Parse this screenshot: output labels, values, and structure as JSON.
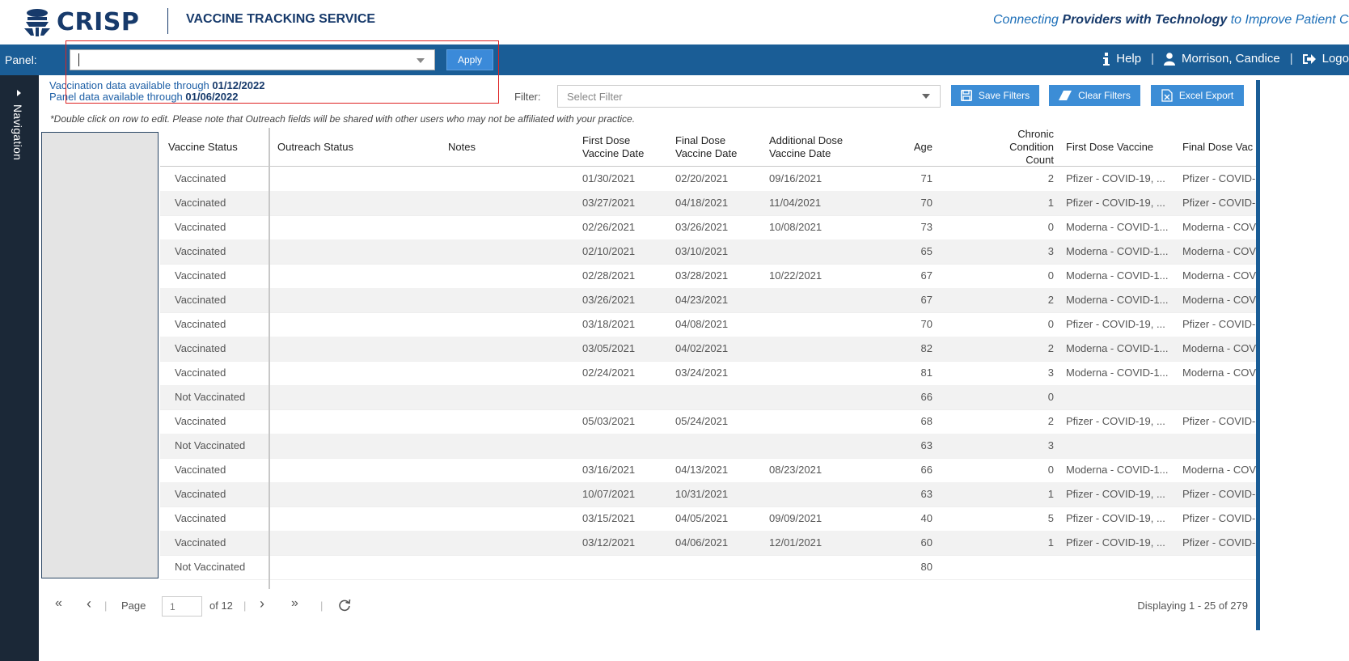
{
  "header": {
    "logo_text": "CRISP",
    "app_title": "VACCINE TRACKING SERVICE",
    "tagline_before": "Connecting ",
    "tagline_bold": "Providers with Technology",
    "tagline_after": " to Improve Patient Ca"
  },
  "panel_bar": {
    "label": "Panel:",
    "panel_value": "",
    "apply_label": "Apply",
    "help_label": "Help",
    "user_name": "Morrison, Candice",
    "logout_label": "Logo"
  },
  "navigation": {
    "label": "Navigation"
  },
  "info": {
    "vax_text": "Vaccination data available through ",
    "vax_date": "01/12/2022",
    "panel_text": "Panel data available through ",
    "panel_date": "01/06/2022"
  },
  "filter": {
    "label": "Filter:",
    "placeholder": "Select Filter",
    "save_label": "Save Filters",
    "clear_label": "Clear Filters",
    "export_label": "Excel Export"
  },
  "note": "*Double click on row to edit. Please note that Outreach fields will be shared with other users who may not be affiliated with your practice.",
  "table": {
    "columns": [
      {
        "l1": "Vaccine Status",
        "l2": ""
      },
      {
        "l1": "Outreach Status",
        "l2": ""
      },
      {
        "l1": "Notes",
        "l2": ""
      },
      {
        "l1": "First Dose",
        "l2": "Vaccine Date"
      },
      {
        "l1": "Final Dose",
        "l2": "Vaccine Date"
      },
      {
        "l1": "Additional Dose",
        "l2": "Vaccine Date"
      },
      {
        "l1": "Age",
        "l2": ""
      },
      {
        "l1": "Chronic",
        "l2": "Condition Count"
      },
      {
        "l1": "First Dose Vaccine",
        "l2": ""
      },
      {
        "l1": "Final Dose Vac",
        "l2": ""
      }
    ],
    "rows": [
      [
        "Vaccinated",
        "",
        "",
        "01/30/2021",
        "02/20/2021",
        "09/16/2021",
        "71",
        "2",
        "Pfizer - COVID-19, ...",
        "Pfizer - COVID-"
      ],
      [
        "Vaccinated",
        "",
        "",
        "03/27/2021",
        "04/18/2021",
        "11/04/2021",
        "70",
        "1",
        "Pfizer - COVID-19, ...",
        "Pfizer - COVID-"
      ],
      [
        "Vaccinated",
        "",
        "",
        "02/26/2021",
        "03/26/2021",
        "10/08/2021",
        "73",
        "0",
        "Moderna - COVID-1...",
        "Moderna - COV"
      ],
      [
        "Vaccinated",
        "",
        "",
        "02/10/2021",
        "03/10/2021",
        "",
        "65",
        "3",
        "Moderna - COVID-1...",
        "Moderna - COV"
      ],
      [
        "Vaccinated",
        "",
        "",
        "02/28/2021",
        "03/28/2021",
        "10/22/2021",
        "67",
        "0",
        "Moderna - COVID-1...",
        "Moderna - COV"
      ],
      [
        "Vaccinated",
        "",
        "",
        "03/26/2021",
        "04/23/2021",
        "",
        "67",
        "2",
        "Moderna - COVID-1...",
        "Moderna - COV"
      ],
      [
        "Vaccinated",
        "",
        "",
        "03/18/2021",
        "04/08/2021",
        "",
        "70",
        "0",
        "Pfizer - COVID-19, ...",
        "Pfizer - COVID-"
      ],
      [
        "Vaccinated",
        "",
        "",
        "03/05/2021",
        "04/02/2021",
        "",
        "82",
        "2",
        "Moderna - COVID-1...",
        "Moderna - COV"
      ],
      [
        "Vaccinated",
        "",
        "",
        "02/24/2021",
        "03/24/2021",
        "",
        "81",
        "3",
        "Moderna - COVID-1...",
        "Moderna - COV"
      ],
      [
        "Not Vaccinated",
        "",
        "",
        "",
        "",
        "",
        "66",
        "0",
        "",
        ""
      ],
      [
        "Vaccinated",
        "",
        "",
        "05/03/2021",
        "05/24/2021",
        "",
        "68",
        "2",
        "Pfizer - COVID-19, ...",
        "Pfizer - COVID-"
      ],
      [
        "Not Vaccinated",
        "",
        "",
        "",
        "",
        "",
        "63",
        "3",
        "",
        ""
      ],
      [
        "Vaccinated",
        "",
        "",
        "03/16/2021",
        "04/13/2021",
        "08/23/2021",
        "66",
        "0",
        "Moderna - COVID-1...",
        "Moderna - COV"
      ],
      [
        "Vaccinated",
        "",
        "",
        "10/07/2021",
        "10/31/2021",
        "",
        "63",
        "1",
        "Pfizer - COVID-19, ...",
        "Pfizer - COVID-"
      ],
      [
        "Vaccinated",
        "",
        "",
        "03/15/2021",
        "04/05/2021",
        "09/09/2021",
        "40",
        "5",
        "Pfizer - COVID-19, ...",
        "Pfizer - COVID-"
      ],
      [
        "Vaccinated",
        "",
        "",
        "03/12/2021",
        "04/06/2021",
        "12/01/2021",
        "60",
        "1",
        "Pfizer - COVID-19, ...",
        "Pfizer - COVID-"
      ],
      [
        "Not Vaccinated",
        "",
        "",
        "",
        "",
        "",
        "80",
        "",
        "",
        ""
      ]
    ]
  },
  "pager": {
    "first": "«",
    "prev": "‹",
    "page_label": "Page",
    "page_value": "1",
    "of_label": "of 12",
    "next": "›",
    "last": "»",
    "display_text": "Displaying 1 - 25 of 279"
  },
  "colors": {
    "navy": "#173a6b",
    "panel_blue": "#1a5d96",
    "button_blue": "#3c8dd6",
    "nav_dark": "#1b2837"
  }
}
